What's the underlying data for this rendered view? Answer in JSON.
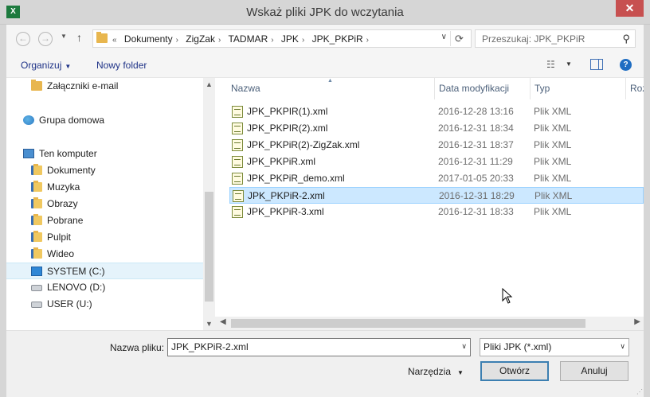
{
  "window": {
    "title": "Wskaż pliki JPK do wczytania",
    "app_icon_text": "X",
    "close_label": "✕"
  },
  "address": {
    "crumbs": [
      "Dokumenty",
      "ZigZak",
      "TADMAR",
      "JPK",
      "JPK_PKPiR"
    ],
    "overflow": "«",
    "search_placeholder": "Przeszukaj: JPK_PKPiR"
  },
  "toolbar": {
    "organize_label": "Organizuj",
    "new_folder_label": "Nowy folder"
  },
  "navpane": {
    "items": [
      {
        "label": "Załączniki e-mail",
        "icon": "folder-icon"
      },
      {
        "label": "Grupa domowa",
        "icon": "homegroup-icon"
      },
      {
        "label": "Ten komputer",
        "icon": "computer-icon"
      },
      {
        "label": "Dokumenty",
        "icon": "documents-folder-icon"
      },
      {
        "label": "Muzyka",
        "icon": "music-folder-icon"
      },
      {
        "label": "Obrazy",
        "icon": "pictures-folder-icon"
      },
      {
        "label": "Pobrane",
        "icon": "downloads-folder-icon"
      },
      {
        "label": "Pulpit",
        "icon": "desktop-folder-icon"
      },
      {
        "label": "Wideo",
        "icon": "video-folder-icon"
      },
      {
        "label": "SYSTEM (C:)",
        "icon": "system-drive-icon"
      },
      {
        "label": "LENOVO (D:)",
        "icon": "drive-icon"
      },
      {
        "label": "USER (U:)",
        "icon": "drive-icon"
      }
    ],
    "selected_index": 9
  },
  "filelist": {
    "columns": {
      "name": "Nazwa",
      "date": "Data modyfikacji",
      "type": "Typ",
      "size": "Roz"
    },
    "rows": [
      {
        "name": "JPK_PKPIR(1).xml",
        "date": "2016-12-28 13:16",
        "type": "Plik XML"
      },
      {
        "name": "JPK_PKPIR(2).xml",
        "date": "2016-12-31 18:34",
        "type": "Plik XML"
      },
      {
        "name": "JPK_PKPiR(2)-ZigZak.xml",
        "date": "2016-12-31 18:37",
        "type": "Plik XML"
      },
      {
        "name": "JPK_PKPiR.xml",
        "date": "2016-12-31 11:29",
        "type": "Plik XML"
      },
      {
        "name": "JPK_PKPiR_demo.xml",
        "date": "2017-01-05 20:33",
        "type": "Plik XML"
      },
      {
        "name": "JPK_PKPiR-2.xml",
        "date": "2016-12-31 18:29",
        "type": "Plik XML"
      },
      {
        "name": "JPK_PKPiR-3.xml",
        "date": "2016-12-31 18:33",
        "type": "Plik XML"
      }
    ],
    "selected_index": 5
  },
  "bottom": {
    "filename_label": "Nazwa pliku:",
    "filename_value": "JPK_PKPiR-2.xml",
    "filetype_value": "Pliki JPK (*.xml)",
    "tools_label": "Narzędzia",
    "open_label": "Otwórz",
    "cancel_label": "Anuluj"
  }
}
